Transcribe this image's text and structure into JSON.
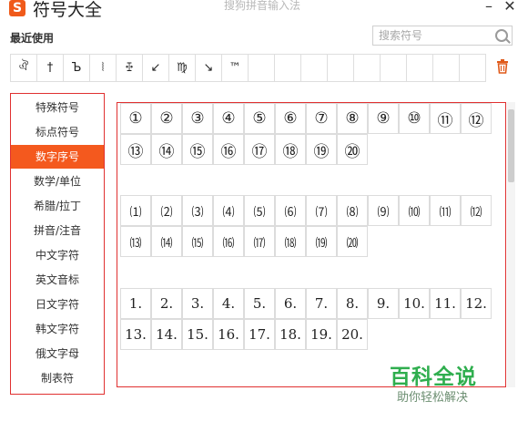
{
  "title_bar": {
    "app_icon": "sogou-s-logo",
    "title": "符号大全",
    "source_title": "搜狗拼音输入法",
    "minimize_icon": "minimize-icon",
    "close_icon": "close-icon"
  },
  "recent": {
    "label": "最近使用",
    "search_placeholder": "搜索符号",
    "symbols": [
      "ঐ",
      "†",
      "Ъ",
      "⦚",
      "ꔀ",
      "↙",
      "♍",
      "↘",
      "™",
      "",
      "",
      "",
      "",
      "",
      "",
      "",
      "",
      ""
    ],
    "trash_icon": "trash-icon"
  },
  "sidebar": {
    "active_index": 2,
    "items": [
      "特殊符号",
      "标点符号",
      "数字序号",
      "数学/单位",
      "希腊/拉丁",
      "拼音/注音",
      "中文字符",
      "英文音标",
      "日文字符",
      "韩文字符",
      "俄文字母",
      "制表符"
    ]
  },
  "symbol_grid": {
    "circled": [
      "①",
      "②",
      "③",
      "④",
      "⑤",
      "⑥",
      "⑦",
      "⑧",
      "⑨",
      "⑩",
      "⑪",
      "⑫",
      "⑬",
      "⑭",
      "⑮",
      "⑯",
      "⑰",
      "⑱",
      "⑲",
      "⑳"
    ],
    "parenthesized": [
      "⑴",
      "⑵",
      "⑶",
      "⑷",
      "⑸",
      "⑹",
      "⑺",
      "⑻",
      "⑼",
      "⑽",
      "⑾",
      "⑿",
      "⒀",
      "⒁",
      "⒂",
      "⒃",
      "⒄",
      "⒅",
      "⒆",
      "⒇"
    ],
    "dotted": [
      "1.",
      "2.",
      "3.",
      "4.",
      "5.",
      "6.",
      "7.",
      "8.",
      "9.",
      "10.",
      "11.",
      "12.",
      "13.",
      "14.",
      "15.",
      "16.",
      "17.",
      "18.",
      "19.",
      "20."
    ]
  },
  "watermark": {
    "main": "百科全说",
    "sub": "助你轻松解决"
  }
}
